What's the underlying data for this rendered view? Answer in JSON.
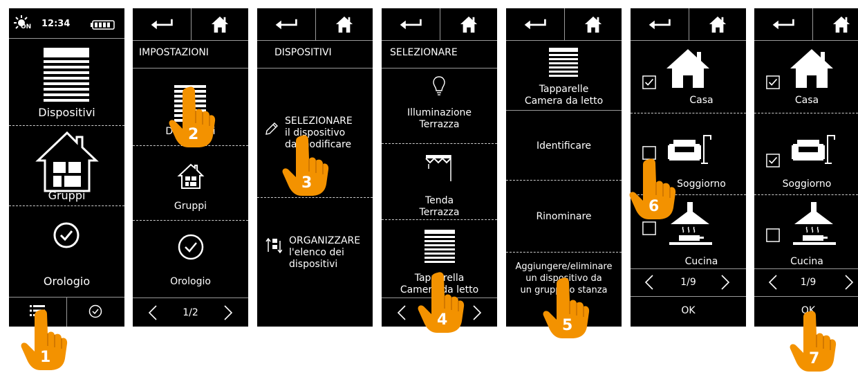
{
  "screen1": {
    "status_time": "12:34",
    "status_on": "ON",
    "item_devices": "Dispositivi",
    "item_groups": "Gruppi",
    "item_clock": "Orologio"
  },
  "screen2": {
    "title": "IMPOSTAZIONI",
    "item_devices": "Dispositivi",
    "item_groups": "Gruppi",
    "item_clock": "Orologio",
    "pagination": "1/2"
  },
  "screen3": {
    "title": "DISPOSITIVI",
    "select_title": "SELEZIONARE",
    "select_line2": "il dispositivo",
    "select_line3": "da modificare",
    "organize_title": "ORGANIZZARE",
    "organize_line2": "l'elenco dei",
    "organize_line3": "dispositivi"
  },
  "screen4": {
    "title": "SELEZIONARE",
    "items": [
      {
        "line1": "Illuminazione",
        "line2": "Terrazza"
      },
      {
        "line1": "Tenda",
        "line2": "Terrazza"
      },
      {
        "line1": "Tapparella",
        "line2": "Camera da letto"
      }
    ],
    "pagination": "1/3"
  },
  "screen5": {
    "device_line1": "Tapparelle",
    "device_line2": "Camera da letto",
    "identify": "Identificare",
    "rename": "Rinominare",
    "group_line1": "Aggiungere/eliminare",
    "group_line2": "un dispositivo da",
    "group_line3": "un gruppo o stanza"
  },
  "screen6": {
    "groups": [
      {
        "label": "Casa",
        "checked": true
      },
      {
        "label": "Soggiorno",
        "checked": false
      },
      {
        "label": "Cucina",
        "checked": false
      }
    ],
    "pagination": "1/9",
    "ok": "OK"
  },
  "screen7": {
    "groups": [
      {
        "label": "Casa",
        "checked": true
      },
      {
        "label": "Soggiorno",
        "checked": true
      },
      {
        "label": "Cucina",
        "checked": false
      }
    ],
    "pagination": "1/9",
    "ok": "OK"
  },
  "steps": [
    "1",
    "2",
    "3",
    "4",
    "5",
    "6",
    "7"
  ],
  "colors": {
    "hand": "#f39200",
    "screen": "#000000",
    "text": "#ffffff"
  }
}
